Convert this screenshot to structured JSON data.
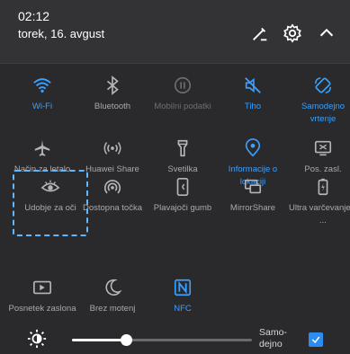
{
  "header": {
    "time": "02:12",
    "date": "torek, 16. avgust"
  },
  "tiles": [
    {
      "label": "Wi-Fi",
      "icon": "wifi-icon",
      "state": "active"
    },
    {
      "label": "Bluetooth",
      "icon": "bluetooth-icon",
      "state": "off"
    },
    {
      "label": "Mobilni podatki",
      "icon": "mobile-data-icon",
      "state": "dim"
    },
    {
      "label": "Tiho",
      "icon": "mute-icon",
      "state": "active"
    },
    {
      "label": "Samodejno vrtenje",
      "icon": "auto-rotate-icon",
      "state": "active"
    },
    {
      "label": "Način za letalo",
      "icon": "airplane-icon",
      "state": "off"
    },
    {
      "label": "Huawei Share",
      "icon": "huawei-share-icon",
      "state": "off"
    },
    {
      "label": "Svetilka",
      "icon": "flashlight-icon",
      "state": "off"
    },
    {
      "label": "Informacije o lokaciji",
      "icon": "location-icon",
      "state": "active"
    },
    {
      "label": "Pos. zasl.",
      "icon": "screenshot-icon",
      "state": "off"
    },
    {
      "label": "Udobje za oči",
      "icon": "eye-comfort-icon",
      "state": "off"
    },
    {
      "label": "Dostopna točka",
      "icon": "hotspot-icon",
      "state": "off"
    },
    {
      "label": "Plavajoči gumb",
      "icon": "floating-button-icon",
      "state": "off"
    },
    {
      "label": "MirrorShare",
      "icon": "mirrorshare-icon",
      "state": "off"
    },
    {
      "label": "Ultra varčevanje z ...",
      "icon": "ultra-battery-icon",
      "state": "off"
    },
    {
      "label": "Posnetek zaslona",
      "icon": "screen-record-icon",
      "state": "off"
    },
    {
      "label": "Brez motenj",
      "icon": "moon-icon",
      "state": "off"
    },
    {
      "label": "NFC",
      "icon": "nfc-icon",
      "state": "active"
    }
  ],
  "brightness": {
    "level": 0.3,
    "auto_label": "Samo-\ndejno",
    "auto_checked": true
  },
  "colors": {
    "active": "#3aa0ff",
    "inactive": "#a9a9ad",
    "background": "#2a2a2c"
  }
}
